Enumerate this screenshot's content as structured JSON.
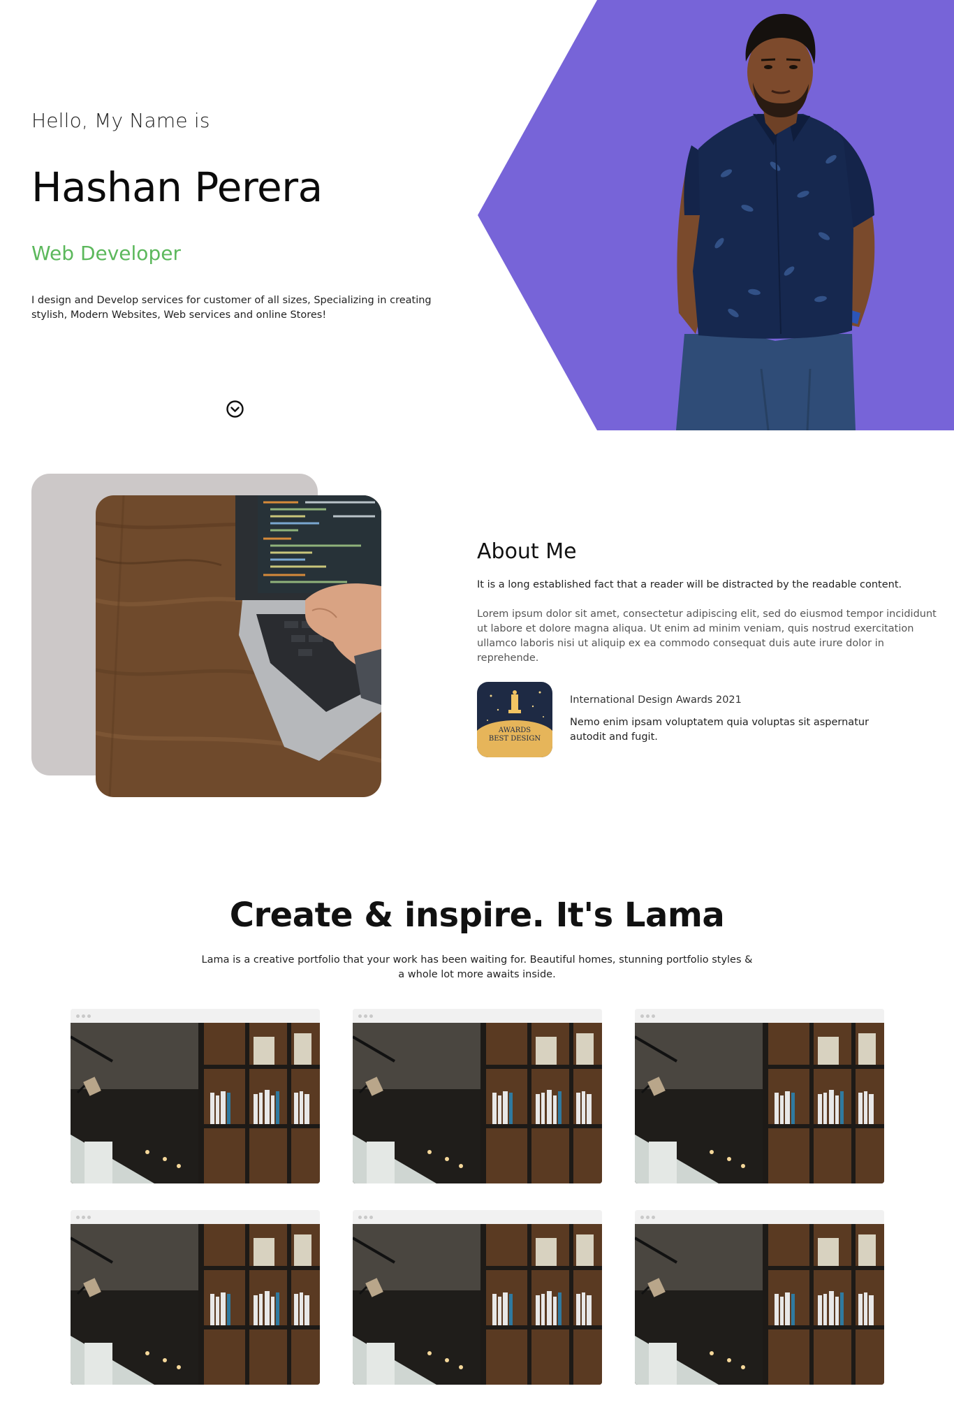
{
  "hero": {
    "intro": "Hello, My Name is",
    "name": "Hashan Perera",
    "role": "Web Developer",
    "description": "I design and Develop services for customer of all sizes, Specializing in creating stylish, Modern Websites, Web services and online Stores!",
    "scroll_icon": "chevron-down-circle-icon",
    "accent_color": "#7764d8",
    "role_color": "#5cb85c"
  },
  "about": {
    "title": "About Me",
    "subtitle": "It is a long established fact that a reader will be distracted by the readable content.",
    "description": "Lorem ipsum dolor sit amet, consectetur adipiscing elit, sed do eiusmod tempor incididunt ut labore et dolore magna aliqua. Ut enim ad minim veniam, quis nostrud exercitation ullamco laboris nisi ut aliquip ex ea commodo consequat duis aute irure dolor in reprehende.",
    "award": {
      "badge_line1": "AWARDS",
      "badge_line2": "BEST DESIGN",
      "title": "International Design Awards 2021",
      "description": "Nemo enim ipsam voluptatem quia voluptas sit aspernatur autodit and fugit."
    }
  },
  "portfolio": {
    "title": "Create & inspire. It's Lama",
    "description": "Lama is a creative portfolio that your work has been waiting for. Beautiful homes, stunning portfolio styles & a whole lot more awaits inside.",
    "items": [
      {
        "image": "bookshelf-library-photo"
      },
      {
        "image": "bookshelf-library-photo"
      },
      {
        "image": "bookshelf-library-photo"
      },
      {
        "image": "bookshelf-library-photo"
      },
      {
        "image": "bookshelf-library-photo"
      },
      {
        "image": "bookshelf-library-photo"
      }
    ]
  }
}
